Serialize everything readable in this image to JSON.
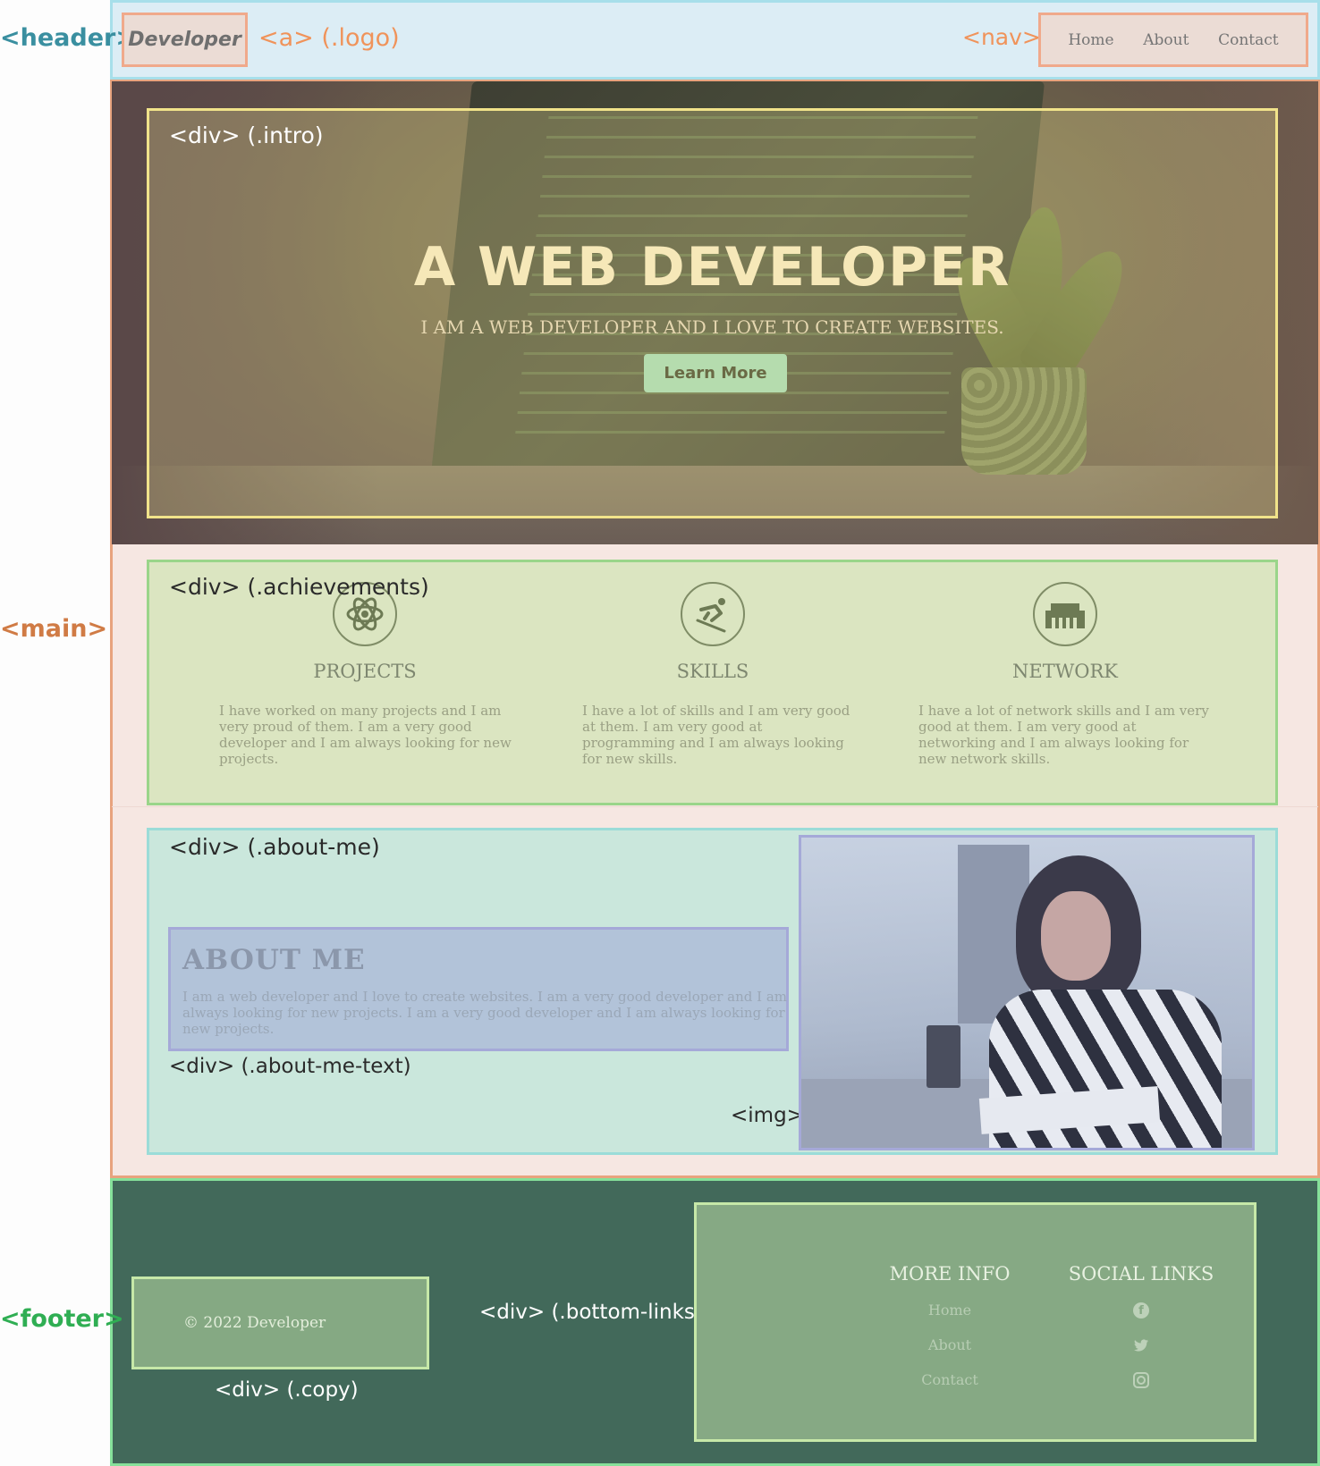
{
  "colors": {
    "header_bg": "#dcedf5",
    "header_border": "#a7dfea",
    "header_label": "#3a8fa0",
    "main_label": "#d07b45",
    "footer_label": "#2fae53",
    "a_nav_label": "#f0935a",
    "footer_bg": "#42695a"
  },
  "labels": {
    "header": "<header>",
    "logo": "<a> (.logo)",
    "nav": "<nav>",
    "main": "<main>",
    "intro": "<div> (.intro)",
    "achievements": "<div> (.achievements)",
    "about_me": "<div> (.about-me)",
    "about_me_text": "<div> (.about-me-text)",
    "img": "<img>",
    "footer": "<footer>",
    "bottom_links": "<div> (.bottom-links)",
    "copy": "<div> (.copy)"
  },
  "header": {
    "logo_text": "Developer",
    "nav_items": [
      "Home",
      "About",
      "Contact"
    ]
  },
  "intro": {
    "title": "A WEB DEVELOPER",
    "subtitle": "I AM A WEB DEVELOPER AND I LOVE TO CREATE WEBSITES.",
    "button": "Learn More"
  },
  "achievements": [
    {
      "icon": "atom-icon",
      "title": "PROJECTS",
      "text": "I have worked on many projects and I am very proud of them. I am a very good developer and I am always looking for new projects."
    },
    {
      "icon": "skiing-icon",
      "title": "SKILLS",
      "text": "I have a lot of skills and I am very good at them. I am very good at programming and I am always looking for new skills."
    },
    {
      "icon": "ethernet-icon",
      "title": "NETWORK",
      "text": "I have a lot of network skills and I am very good at them. I am very good at networking and I am always looking for new network skills."
    }
  ],
  "about": {
    "title": "ABOUT ME",
    "text": "I am a web developer and I love to create websites. I am a very good developer and I am always looking for new projects. I am a very good developer and I am always looking for new projects."
  },
  "footer": {
    "copy": "© 2022 Developer",
    "more_info_title": "MORE INFO",
    "more_info_links": [
      "Home",
      "About",
      "Contact"
    ],
    "social_title": "SOCIAL LINKS",
    "social_icons": [
      "facebook-icon",
      "twitter-icon",
      "instagram-icon"
    ]
  }
}
